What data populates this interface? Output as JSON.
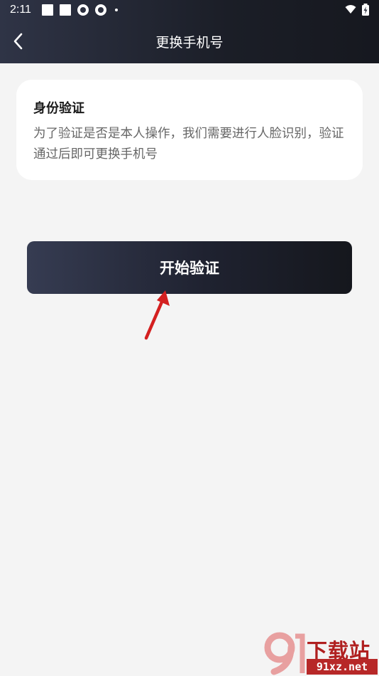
{
  "status_bar": {
    "time": "2:11"
  },
  "header": {
    "title": "更换手机号",
    "back_icon": "chevron-left-icon"
  },
  "verify_card": {
    "title": "身份验证",
    "description": "为了验证是否是本人操作，我们需要进行人脸识别，验证通过后即可更换手机号"
  },
  "actions": {
    "start_label": "开始验证"
  },
  "watermark": {
    "brand": "下载站",
    "url": "91xz.net"
  },
  "colors": {
    "header_bg": "#1b1e27",
    "page_bg": "#f4f4f4",
    "button_bg": "#1f2230",
    "annotation_arrow": "#d42020"
  }
}
